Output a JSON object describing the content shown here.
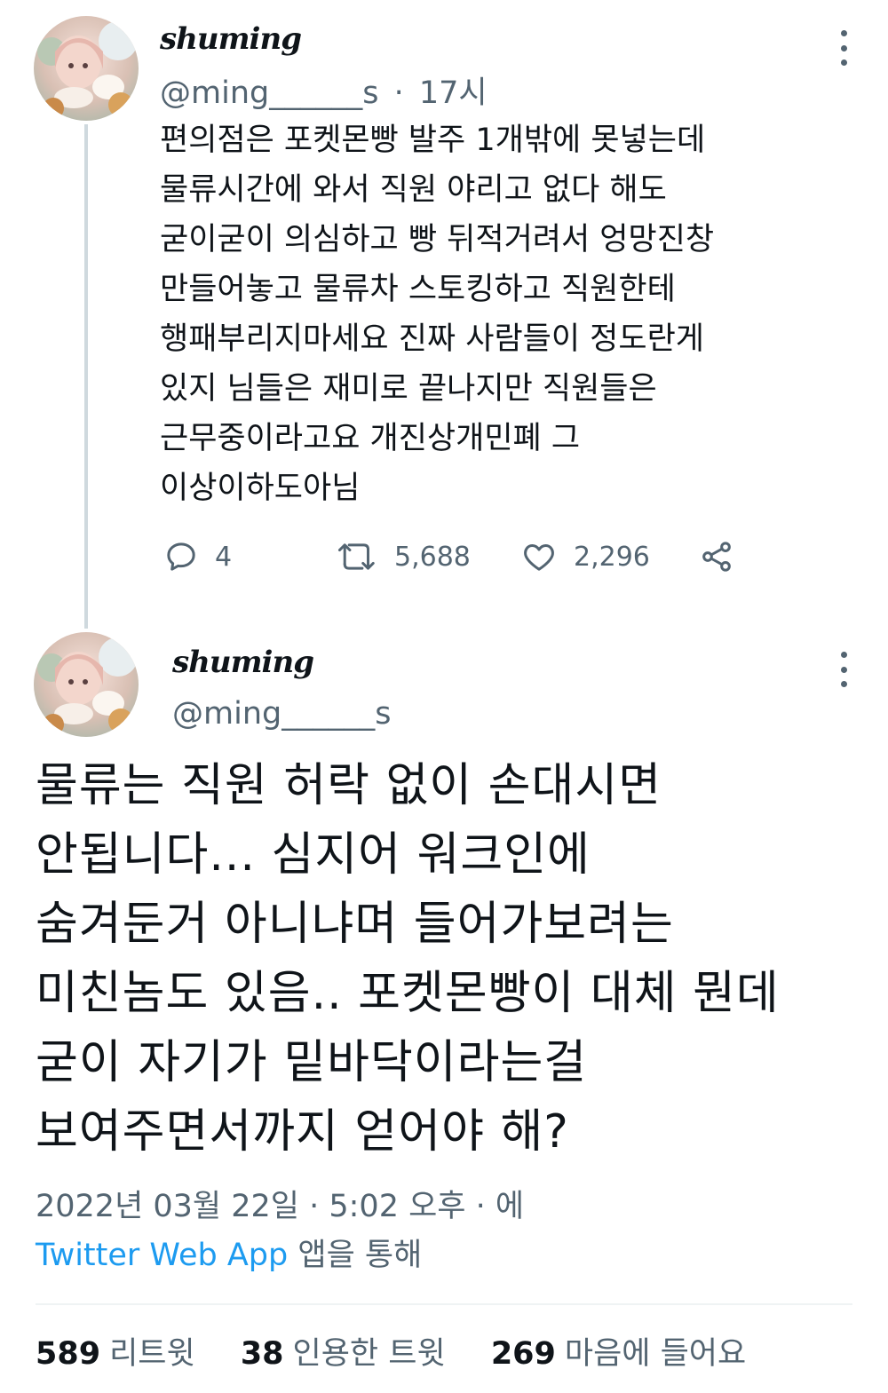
{
  "tweet1": {
    "display_name": "shuming",
    "handle": "@ming______s",
    "separator": "·",
    "time_ago": "17시",
    "text_lines": [
      "편의점은 포켓몬빵 발주 1개밖에 못넣는데",
      "물류시간에 와서 직원 야리고 없다 해도",
      "굳이굳이 의심하고 빵 뒤적거려서 엉망진창",
      "만들어놓고 물류차 스토킹하고 직원한테",
      "행패부리지마세요 진짜 사람들이 정도란게",
      "있지 님들은 재미로 끝나지만 직원들은",
      "근무중이라고요  개진상개민폐 그",
      "이상이하도아님"
    ],
    "replies": "4",
    "retweets": "5,688",
    "likes": "2,296",
    "icons": [
      "reply-icon",
      "retweet-icon",
      "like-icon",
      "share-icon",
      "more-icon"
    ]
  },
  "tweet2": {
    "display_name": "shuming",
    "handle": "@ming______s",
    "text_lines": [
      "물류는 직원 허락 없이 손대시면",
      "안됩니다... 심지어 워크인에",
      "숨겨둔거 아니냐며 들어가보려는",
      "미친놈도 있음.. 포켓몬빵이 대체 뭔데",
      "굳이 자기가 밑바닥이라는걸",
      "보여주면서까지 얻어야 해?"
    ],
    "timestamp": "2022년 03월 22일 · 5:02 오후 · 에",
    "source_app": "Twitter Web App",
    "source_suffix": " 앱을 통해"
  },
  "stats": {
    "retweets_count": "589",
    "retweets_label": "리트윗",
    "quotes_count": "38",
    "quotes_label": "인용한 트윗",
    "likes_count": "269",
    "likes_label": "마음에 들어요"
  },
  "colors": {
    "text_primary": "#0f1419",
    "text_secondary": "#536471",
    "link": "#1d9bf0",
    "thread_line": "#cfd9de"
  }
}
